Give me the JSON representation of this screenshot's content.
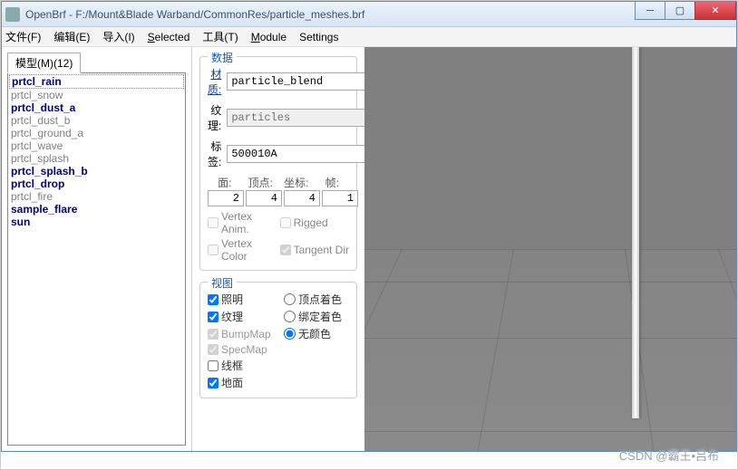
{
  "window": {
    "title": "OpenBrf - F:/Mount&Blade Warband/CommonRes/particle_meshes.brf"
  },
  "menu": {
    "file": "文件(F)",
    "edit": "编辑(E)",
    "import": "导入(I)",
    "selected": "Selected",
    "tools": "工具(T)",
    "module": "Module",
    "settings": "Settings"
  },
  "tab": {
    "label": "模型(M)(12)"
  },
  "list": [
    {
      "n": "prtcl_rain",
      "bold": true,
      "sel": true
    },
    {
      "n": "prtcl_snow",
      "bold": false
    },
    {
      "n": "prtcl_dust_a",
      "bold": true
    },
    {
      "n": "prtcl_dust_b",
      "bold": false
    },
    {
      "n": "prtcl_ground_a",
      "bold": false
    },
    {
      "n": "prtcl_wave",
      "bold": false
    },
    {
      "n": "prtcl_splash",
      "bold": false
    },
    {
      "n": "prtcl_splash_b",
      "bold": true
    },
    {
      "n": "prtcl_drop",
      "bold": true
    },
    {
      "n": "prtcl_fire",
      "bold": false
    },
    {
      "n": "sample_flare",
      "bold": true
    },
    {
      "n": "sun",
      "bold": true
    }
  ],
  "data_panel": {
    "title": "数据",
    "mat_label": "材质:",
    "mat_value": "particle_blend",
    "tex_label": "纹理:",
    "tex_value": "particles",
    "tag_label": "标签:",
    "tag_value": "500010A",
    "tag_btn": "...",
    "faces_label": "面:",
    "verts_label": "顶点:",
    "coords_label": "坐标:",
    "frames_label": "帧:",
    "faces": "2",
    "verts": "4",
    "coords": "4",
    "frames": "1",
    "vanim": "Vertex Anim.",
    "rigged": "Rigged",
    "vcolor": "Vertex Color",
    "tangent": "Tangent Dir"
  },
  "view_panel": {
    "title": "视图",
    "lighting": "照明",
    "texture": "纹理",
    "bump": "BumpMap",
    "spec": "SpecMap",
    "wire": "线框",
    "ground": "地面",
    "vshade": "顶点着色",
    "bshade": "绑定着色",
    "noshade": "无颜色"
  },
  "watermark": "CSDN @霸王•吕布"
}
